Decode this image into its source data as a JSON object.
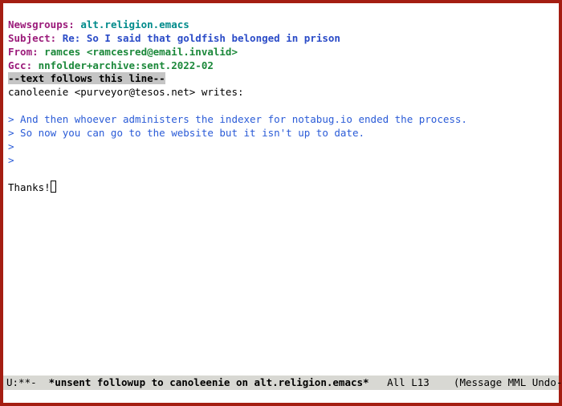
{
  "headers": {
    "newsgroups_label": "Newsgroups:",
    "newsgroups_value": " alt.religion.emacs",
    "subject_label": "Subject:",
    "subject_value": " Re: So I said that goldfish belonged in prison",
    "from_label": "From:",
    "from_value": " ramces <ramcesred@email.invalid>",
    "gcc_label": "Gcc:",
    "gcc_value": " nnfolder+archive:sent.2022-02",
    "separator": "--text follows this line--"
  },
  "body": {
    "cite": "canoleenie <purveyor@tesos.net> writes:",
    "quoted": [
      "> And then whoever administers the indexer for notabug.io ended the process.",
      "> So now you can go to the website but it isn't up to date.",
      ">",
      ">"
    ],
    "text": "Thanks!"
  },
  "modeline": {
    "left": "U:**- ",
    "buffer_name": " *unsent followup to canoleenie on alt.religion.emacs*",
    "position": "   All L13   ",
    "modes": " (Message MML Undo-Tree"
  }
}
